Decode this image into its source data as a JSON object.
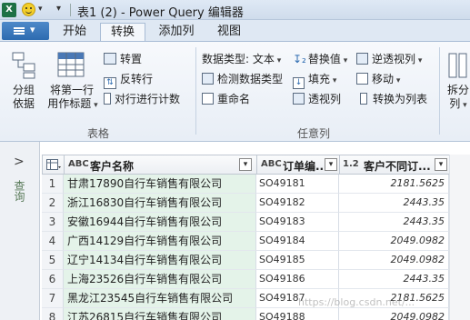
{
  "window": {
    "title": "表1 (2) - Power Query 编辑器",
    "app_icon_letter": "X"
  },
  "tabs": [
    {
      "label": "开始",
      "active": false
    },
    {
      "label": "转换",
      "active": true
    },
    {
      "label": "添加列",
      "active": false
    },
    {
      "label": "视图",
      "active": false
    }
  ],
  "ribbon": {
    "table_group": {
      "label": "表格",
      "group_by": [
        "分组",
        "依据"
      ],
      "first_row_header": [
        "将第一行",
        "用作标题"
      ],
      "transpose": "转置",
      "reverse_rows": "反转行",
      "count_rows": "对行进行计数"
    },
    "any_column_group": {
      "label": "任意列",
      "data_type": "数据类型: 文本",
      "detect_type": "检测数据类型",
      "rename": "重命名",
      "replace_values": "替换值",
      "fill": "填充",
      "pivot_column": "透视列",
      "unpivot": "逆透视列",
      "move": "移动",
      "convert_to_list": "转换为列表"
    },
    "split_column": [
      "拆分",
      "列"
    ]
  },
  "left_pane": {
    "query_label": "查询"
  },
  "grid": {
    "columns": [
      {
        "type_icon": "ABC",
        "name": "客户名称"
      },
      {
        "type_icon": "ABC",
        "name": "订单编..."
      },
      {
        "type_icon": "1.2",
        "name": "客户不同订..."
      }
    ],
    "rows": [
      {
        "n": "1",
        "name": "甘肃17890自行车销售有限公司",
        "code": "SO49181",
        "val": "2181.5625"
      },
      {
        "n": "2",
        "name": "浙江16830自行车销售有限公司",
        "code": "SO49182",
        "val": "2443.35"
      },
      {
        "n": "3",
        "name": "安徽16944自行车销售有限公司",
        "code": "SO49183",
        "val": "2443.35"
      },
      {
        "n": "4",
        "name": "广西14129自行车销售有限公司",
        "code": "SO49184",
        "val": "2049.0982"
      },
      {
        "n": "5",
        "name": "辽宁14134自行车销售有限公司",
        "code": "SO49185",
        "val": "2049.0982"
      },
      {
        "n": "6",
        "name": "上海23526自行车销售有限公司",
        "code": "SO49186",
        "val": "2443.35"
      },
      {
        "n": "7",
        "name": "黑龙江23545自行车销售有限公司",
        "code": "SO49187",
        "val": "2181.5625"
      },
      {
        "n": "8",
        "name": "江苏26815自行车销售有限公司",
        "code": "SO49188",
        "val": "2049.0982"
      }
    ]
  },
  "watermark": "https://blog.csdn.net/..."
}
